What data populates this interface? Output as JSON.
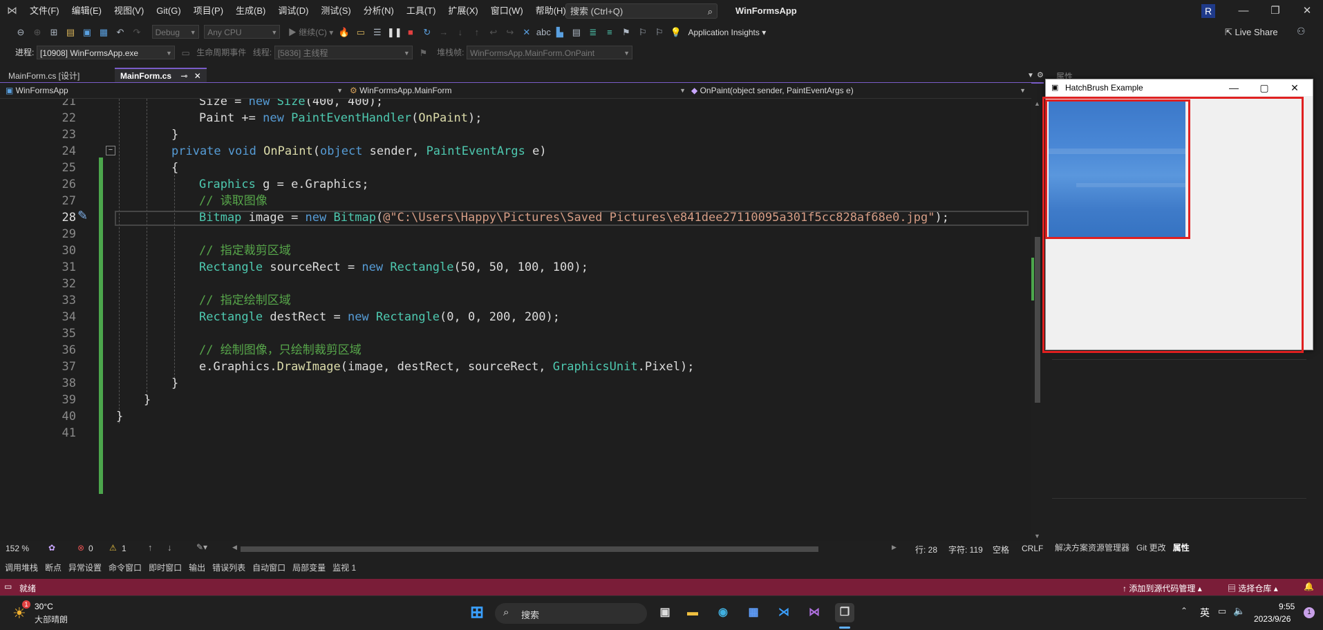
{
  "menu": {
    "items": [
      "文件(F)",
      "编辑(E)",
      "视图(V)",
      "Git(G)",
      "项目(P)",
      "生成(B)",
      "调试(D)",
      "测试(S)",
      "分析(N)",
      "工具(T)",
      "扩展(X)",
      "窗口(W)",
      "帮助(H)"
    ],
    "search_placeholder": "搜索 (Ctrl+Q)",
    "app_title": "WinFormsApp",
    "account_initial": "R"
  },
  "toolbar": {
    "config": "Debug",
    "platform": "Any CPU",
    "continue_label": "继续(C)",
    "app_insights": "Application Insights",
    "live_share": "Live Share"
  },
  "debug_bar": {
    "process_label": "进程:",
    "process_value": "[10908] WinFormsApp.exe",
    "lifecycle_label": "生命周期事件",
    "thread_label": "线程:",
    "thread_value": "[5836] 主线程",
    "stack_label": "堆栈帧:",
    "stack_value": "WinFormsApp.MainForm.OnPaint"
  },
  "tabs": {
    "designer": "MainForm.cs [设计]",
    "code": "MainForm.cs"
  },
  "nav": {
    "project": "WinFormsApp",
    "class": "WinFormsApp.MainForm",
    "member": "OnPaint(object sender, PaintEventArgs e)"
  },
  "code": {
    "lines": [
      {
        "num": "21",
        "text": "Size = new Size(400, 400);"
      },
      {
        "num": "22",
        "text": "Paint += new PaintEventHandler(OnPaint);"
      },
      {
        "num": "23",
        "text": "}"
      },
      {
        "num": "24",
        "text": "private void OnPaint(object sender, PaintEventArgs e)"
      },
      {
        "num": "25",
        "text": "{"
      },
      {
        "num": "26",
        "text": "Graphics g = e.Graphics;"
      },
      {
        "num": "27",
        "text": "// 读取图像"
      },
      {
        "num": "28",
        "text": "Bitmap image = new Bitmap(@\"C:\\Users\\Happy\\Pictures\\Saved Pictures\\e841dee27110095a301f5cc828af68e0.jpg\");"
      },
      {
        "num": "29",
        "text": ""
      },
      {
        "num": "30",
        "text": "// 指定裁剪区域"
      },
      {
        "num": "31",
        "text": "Rectangle sourceRect = new Rectangle(50, 50, 100, 100);"
      },
      {
        "num": "32",
        "text": ""
      },
      {
        "num": "33",
        "text": "// 指定绘制区域"
      },
      {
        "num": "34",
        "text": "Rectangle destRect = new Rectangle(0, 0, 200, 200);"
      },
      {
        "num": "35",
        "text": ""
      },
      {
        "num": "36",
        "text": "// 绘制图像，只绘制裁剪区域"
      },
      {
        "num": "37",
        "text": "e.Graphics.DrawImage(image, destRect, sourceRect, GraphicsUnit.Pixel);"
      },
      {
        "num": "38",
        "text": "}"
      },
      {
        "num": "39",
        "text": "}"
      },
      {
        "num": "40",
        "text": "}"
      },
      {
        "num": "41",
        "text": ""
      }
    ]
  },
  "editor_status": {
    "zoom": "152 %",
    "errors": "0",
    "warnings": "1",
    "line": "行: 28",
    "char": "字符: 119",
    "spaces": "空格",
    "eol": "CRLF"
  },
  "right_panel": {
    "title": "属性",
    "tabs": [
      "解决方案资源管理器",
      "Git 更改",
      "属性"
    ]
  },
  "form_window": {
    "title": "HatchBrush Example"
  },
  "tool_tabs": [
    "调用堆栈",
    "断点",
    "异常设置",
    "命令窗口",
    "即时窗口",
    "输出",
    "错误列表",
    "自动窗口",
    "局部变量",
    "监视 1"
  ],
  "statusbar": {
    "state": "就绪",
    "add_source_control": "添加到源代码管理",
    "select_repo": "选择仓库",
    "notifications": "1"
  },
  "taskbar": {
    "weather_temp": "30°C",
    "weather_desc": "大部晴朗",
    "weather_badge": "1",
    "search": "搜索",
    "ime": "英",
    "time": "9:55",
    "date": "2023/9/26",
    "notif_count": "1"
  },
  "colors": {
    "accent": "#7a5cc9",
    "statusbar": "#7a1d38",
    "highlight_box": "#e02020",
    "change_bar": "#4ca64c"
  }
}
